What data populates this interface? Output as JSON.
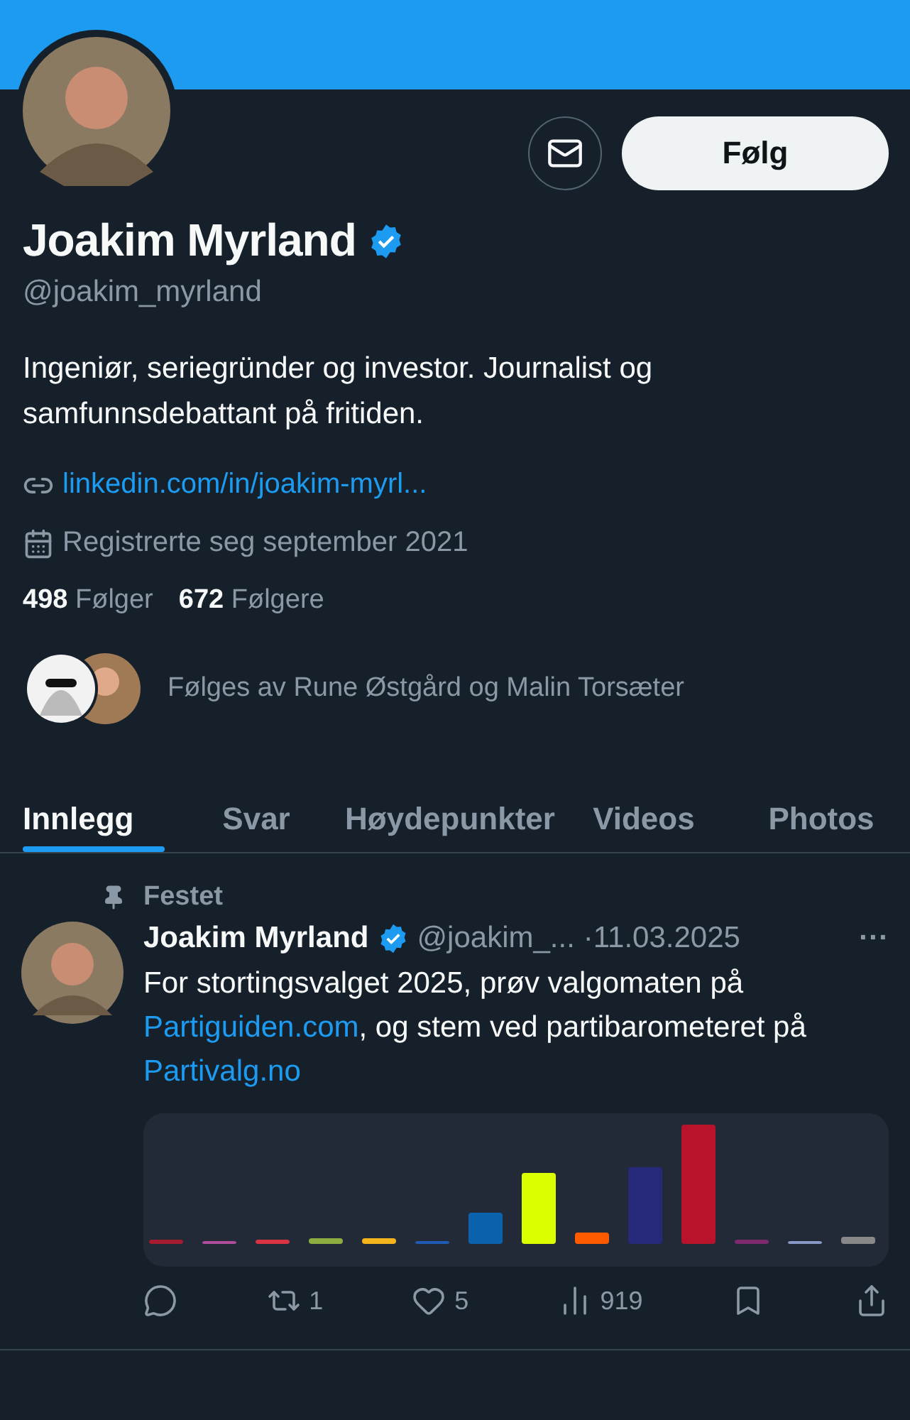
{
  "profile": {
    "name": "Joakim Myrland",
    "verified": true,
    "handle": "@joakim_myrland",
    "bio": "Ingeniør, seriegründer og investor. Journalist og samfunnsdebattant på fritiden.",
    "link": "linkedin.com/in/joakim-myrl...",
    "joined": "Registrerte seg september 2021",
    "following_count": "498",
    "following_label": "Følger",
    "followers_count": "672",
    "followers_label": "Følgere",
    "followed_by": "Følges av Rune Østgård og Malin Torsæter",
    "follow_button": "Følg"
  },
  "tabs": [
    {
      "label": "Innlegg",
      "selected": true
    },
    {
      "label": "Svar",
      "selected": false
    },
    {
      "label": "Høydepunkter",
      "selected": false
    },
    {
      "label": "Videos",
      "selected": false
    },
    {
      "label": "Photos",
      "selected": false
    }
  ],
  "post": {
    "pinned_label": "Festet",
    "author": "Joakim Myrland",
    "verified": true,
    "handle": "@joakim_...",
    "date": "·11.03.2025",
    "more": "···",
    "text": "For stortingsvalget 2025, prøv valgomaten på **Partiguiden.com**, og stem ved partibarometeret på **Partivalg.no**",
    "actions": [
      {
        "kind": "reply"
      },
      {
        "kind": "repost",
        "count": "1"
      },
      {
        "kind": "like",
        "count": "5"
      },
      {
        "kind": "views",
        "count": "919"
      },
      {
        "kind": "bookmark"
      },
      {
        "kind": "share"
      }
    ]
  }
}
